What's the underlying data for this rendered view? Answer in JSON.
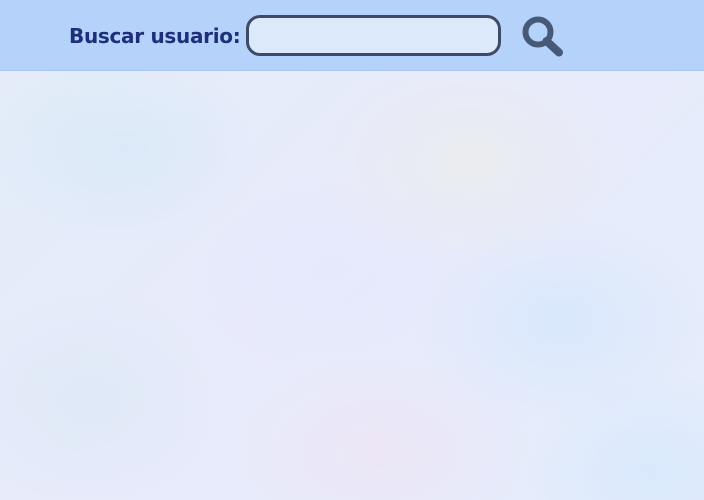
{
  "search": {
    "label": "Buscar usuario:",
    "value": "",
    "placeholder": ""
  },
  "icons": {
    "search_button": "search-icon"
  },
  "colors": {
    "header_background": "#b5d2fb",
    "label_text": "#1f2f7a",
    "input_border": "#3f4a66",
    "input_background": "#dce9fb",
    "icon": "#465a78",
    "content_background": "#e6eefc"
  }
}
